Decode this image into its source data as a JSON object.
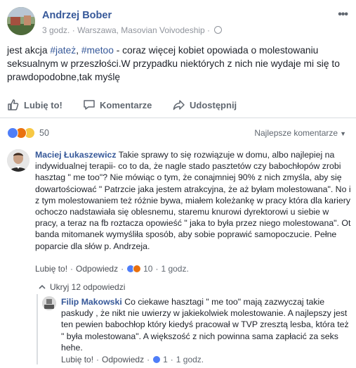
{
  "post": {
    "author": "Andrzej Bober",
    "time": "3 godz.",
    "separator": "·",
    "location": "Warszawa, Masovian Voivodeship",
    "separator2": "·",
    "text_prefix": "jest akcja ",
    "hashtag1": "#jateż",
    "text_middle": ", ",
    "hashtag2": "#metoo",
    "text_suffix": " - coraz więcej kobiet opowiada o molestowaniu seksualnym w przeszłości.W przypadku niektórych z nich nie wydaje mi się to prawdopodobne,tak myślę"
  },
  "actions": {
    "like": "Lubię to!",
    "comment": "Komentarze",
    "share": "Udostępnij"
  },
  "reactions": {
    "count": "50",
    "sort_label": "Najlepsze komentarze",
    "colors": {
      "like": "#4f7ef8",
      "angry": "#e9710f",
      "haha": "#f7c844"
    }
  },
  "comments": [
    {
      "author": "Maciej Łukaszewicz",
      "text": " Takie sprawy to się rozwiązuje w domu, albo najlepiej na indywidualnej terapii- co to da, że nagle stado pasztetów czy babochłopów zrobi hasztag \" me too\"? Nie mówiąc o tym, że conajmniej 90% z nich zmyśla, aby się dowartościować \" Patrzcie jaka jestem atrakcyjna, że aż byłam molestowana\". No i z tym molestowaniem też różnie bywa, miałem koleżankę w pracy która dla kariery ochoczo nadstawiała się oblesnemu, staremu knurowi dyrektorowi u siebie w pracy, a teraz na fb roztacza opowieść \" jaka to była przez niego molestowana\". Ot banda mitomanek wymyśliła sposób, aby sobie poprawić samopoczucie. Pełne poparcie dla słów p. Andrzeja.",
      "like": "Lubię to!",
      "reply": "Odpowiedz",
      "dot": "·",
      "reaction_count": "10",
      "time": "1 godz."
    },
    {
      "author": "Filip Makowski",
      "text": " Co ciekawe hasztagi \" me too\" mają zazwyczaj takie paskudy , że nikt nie uwierzy w jakiekolwiek molestowanie. A najlepszy jest ten pewien babochłop który kiedyś pracował w TVP zresztą lesba, która też \" była molestowana\". A większość z nich powinna sama zapłacić za seks hehe.",
      "like": "Lubię to!",
      "reply": "Odpowiedz",
      "dot": "·",
      "reaction_count": "1",
      "time": "1 godz."
    }
  ],
  "replies_toggle": "Ukryj 12 odpowiedzi"
}
